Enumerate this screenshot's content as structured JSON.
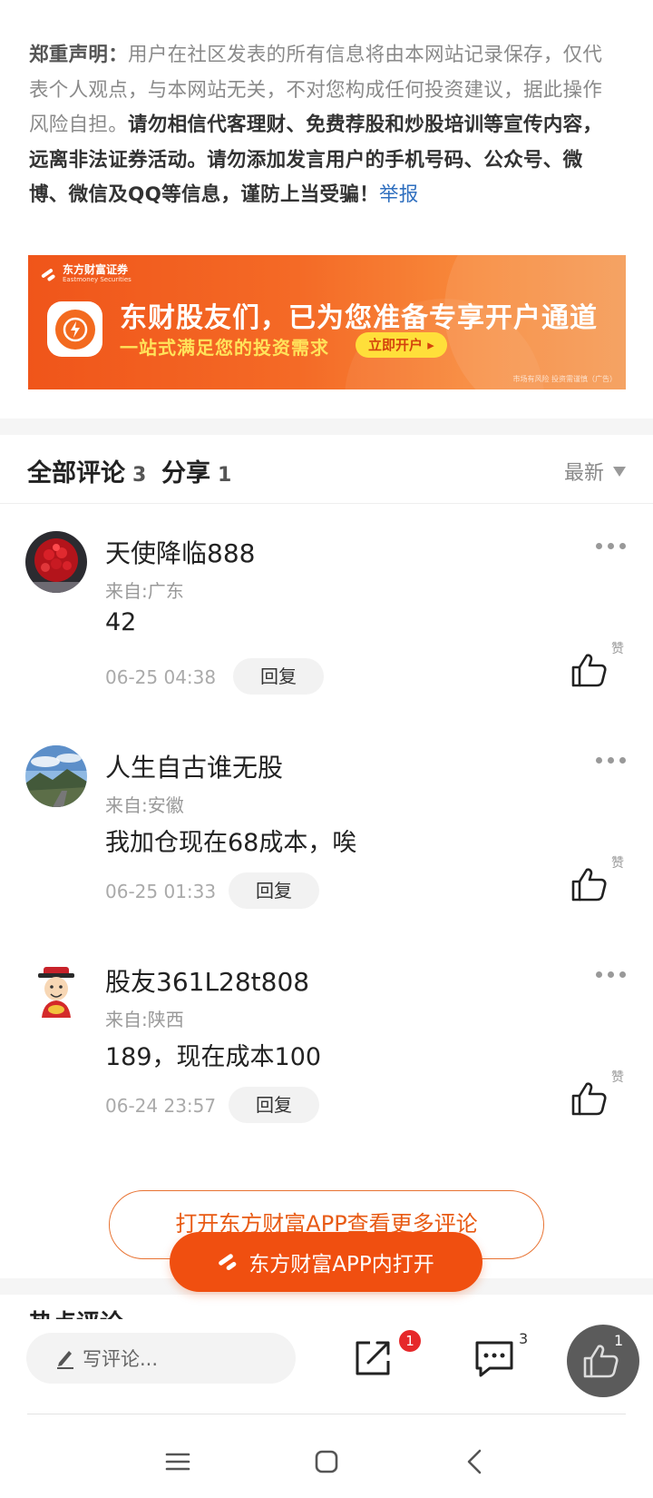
{
  "disclaimer": {
    "lead": "郑重声明：",
    "normal": "用户在社区发表的所有信息将由本网站记录保存，仅代表个人观点，与本网站无关，不对您构成任何投资建议，据此操作风险自担。",
    "bold": "请勿相信代客理财、免费荐股和炒股培训等宣传内容，远离非法证券活动。请勿添加发言用户的手机号码、公众号、微博、微信及QQ等信息，谨防上当受骗！",
    "report_link": "举报"
  },
  "banner": {
    "brand_cn": "东方财富证券",
    "brand_en": "Eastmoney Securities",
    "headline": "东财股友们，已为您准备专享开户通道",
    "subline": "一站式满足您的投资需求",
    "cta": "立即开户 ▸",
    "risk_note": "市场有风险 投资需谨慎（广告）",
    "accent_color": "#f0551a"
  },
  "comments_header": {
    "comments_tab": "全部评论",
    "comments_count": "3",
    "share_tab": "分享",
    "share_count": "1",
    "sort_label": "最新"
  },
  "comments": [
    {
      "username": "天使降临888",
      "location": "来自:广东",
      "content": "42",
      "time": "06-25 04:38",
      "reply_label": "回复",
      "like_label": "赞"
    },
    {
      "username": "人生自古谁无股",
      "location": "来自:安徽",
      "content": "我加仓现在68成本，唉",
      "time": "06-25 01:33",
      "reply_label": "回复",
      "like_label": "赞"
    },
    {
      "username": "股友361L28t808",
      "location": "来自:陕西",
      "content": "189，现在成本100",
      "time": "06-24 23:57",
      "reply_label": "回复",
      "like_label": "赞"
    }
  ],
  "open_more_button": "打开东方财富APP查看更多评论",
  "hot_section_title": "热点评论",
  "float_open_button": "东方财富APP内打开",
  "bottom_bar": {
    "write_placeholder": "写评论...",
    "share_badge": "1",
    "comment_count": "3",
    "like_count": "1"
  },
  "icons": {
    "edit": "pencil-icon",
    "share": "share-icon",
    "comment": "comment-icon",
    "like": "thumbs-up-icon",
    "more": "more-dots-icon",
    "nav_menu": "menu-icon",
    "nav_home": "home-icon",
    "nav_back": "back-icon"
  }
}
